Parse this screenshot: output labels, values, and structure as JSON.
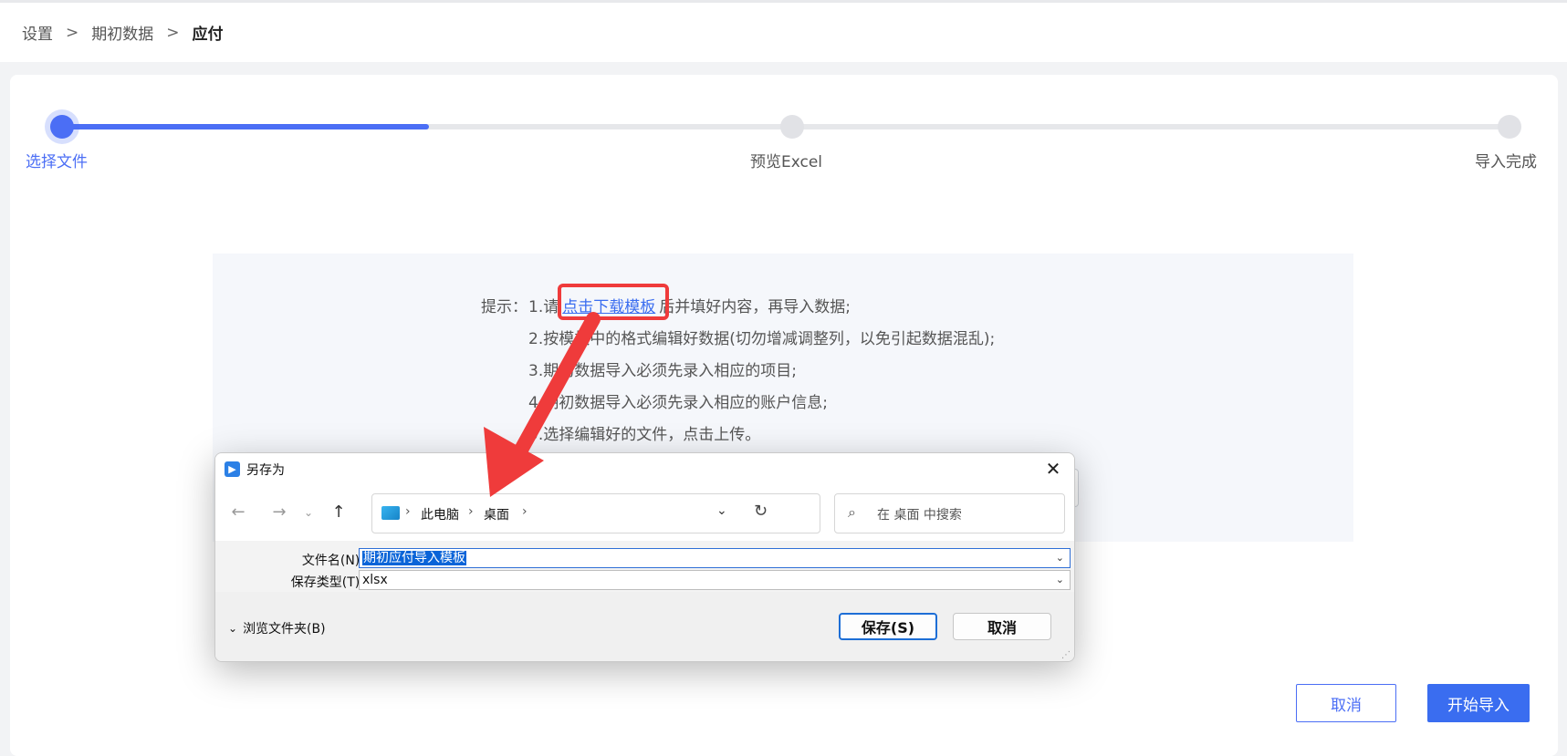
{
  "breadcrumb": {
    "items": [
      "设置",
      "期初数据"
    ],
    "current": "应付",
    "sep": ">"
  },
  "steps": [
    {
      "label": "选择文件",
      "state": "active"
    },
    {
      "label": "预览Excel",
      "state": "pending"
    },
    {
      "label": "导入完成",
      "state": "pending"
    }
  ],
  "step_progress": 0.25,
  "tips": {
    "prefix": "提示：",
    "line1_before": "1.请",
    "link": "点击下载模板",
    "line1_after": "后并填好内容，再导入数据;",
    "line2": "2.按模板中的格式编辑好数据(切勿增减调整列，以免引起数据混乱);",
    "line3": "3.期初数据导入必须先录入相应的项目;",
    "line4": "4.期初数据导入必须先录入相应的账户信息;",
    "line5": "5.选择编辑好的文件，点击上传。"
  },
  "buttons": {
    "cancel": "取消",
    "start": "开始导入"
  },
  "dialog": {
    "title": "另存为",
    "path": [
      "此电脑",
      "桌面"
    ],
    "search_placeholder": "在 桌面 中搜索",
    "filename_label": "文件名(N):",
    "filename_value": "期初应付导入模板",
    "filetype_label": "保存类型(T):",
    "filetype_value": "xlsx",
    "browse_label": "浏览文件夹(B)",
    "save_label": "保存(S)",
    "cancel_label": "取消"
  },
  "colors": {
    "accent": "#3a6df0",
    "annotation": "#ef3b3b"
  },
  "icons": [
    "back-arrow-icon",
    "forward-arrow-icon",
    "up-arrow-icon",
    "computer-icon",
    "refresh-icon",
    "search-icon",
    "close-icon"
  ]
}
